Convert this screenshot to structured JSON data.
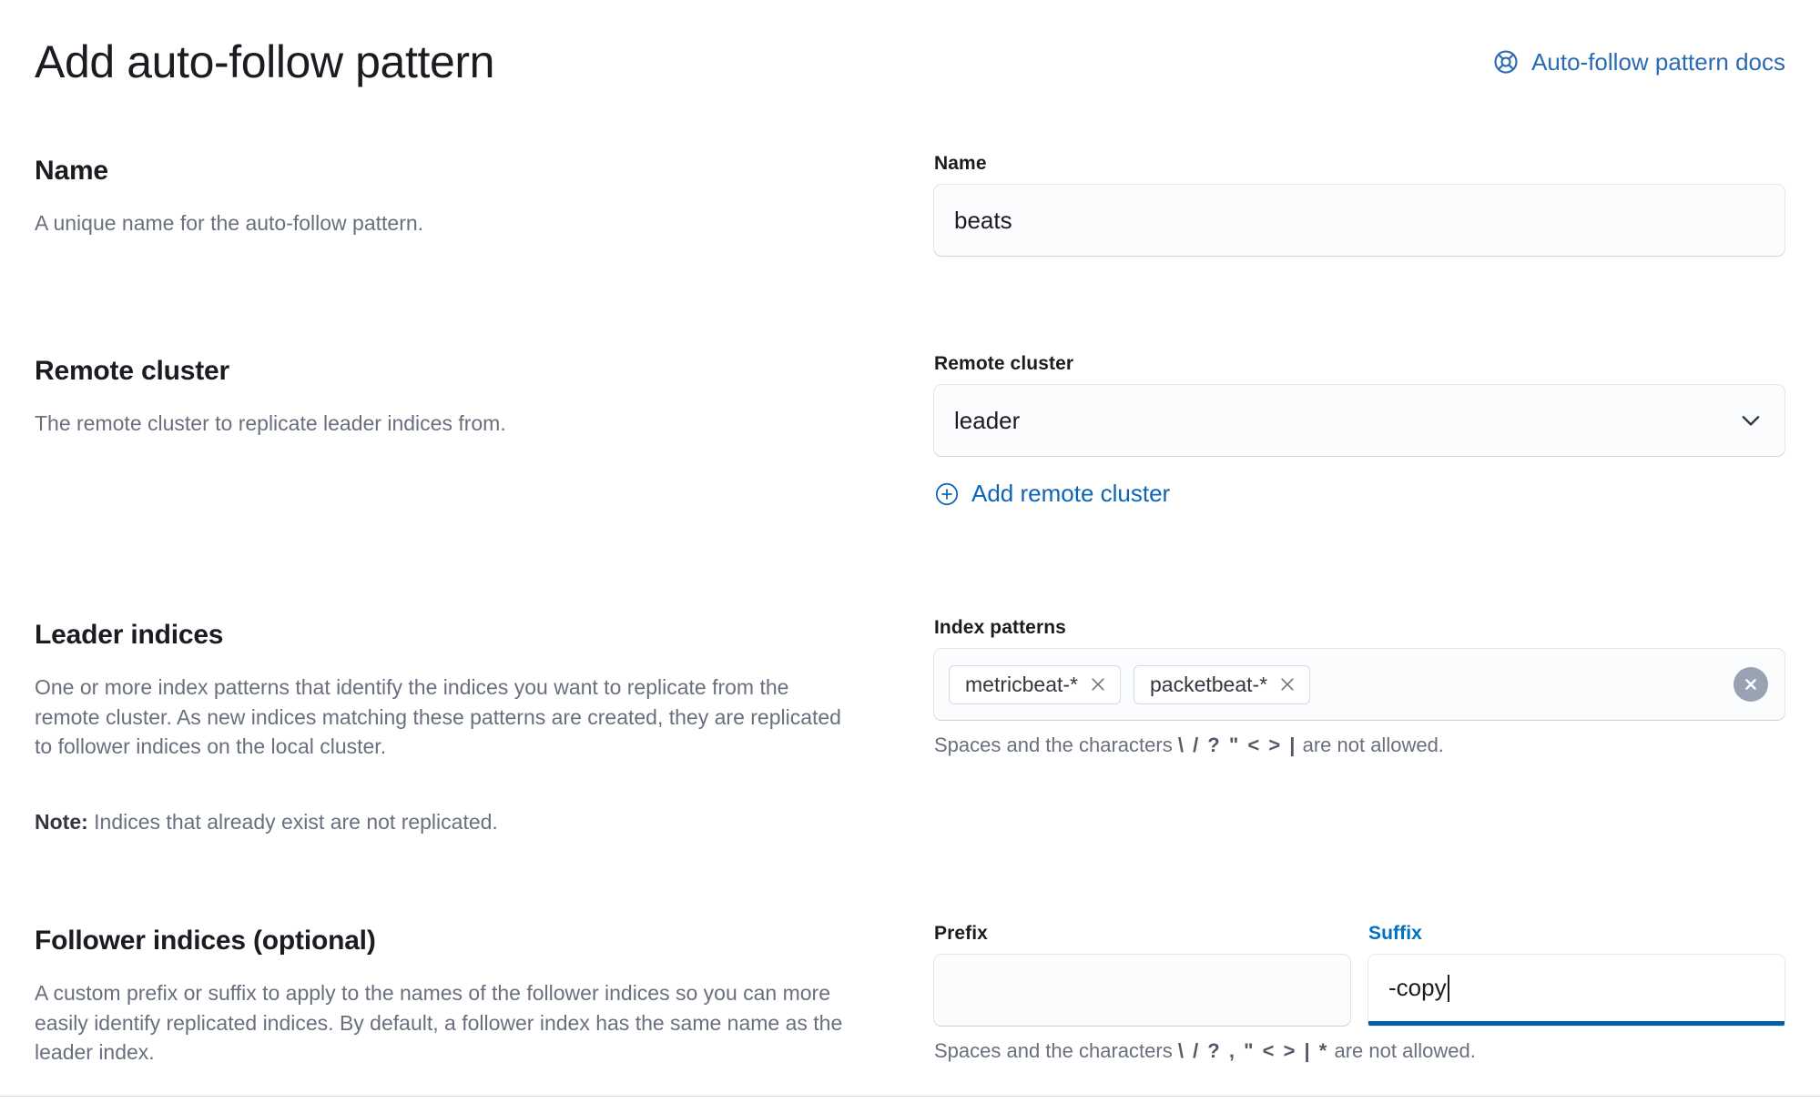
{
  "header": {
    "title": "Add auto-follow pattern",
    "docs_link_label": "Auto-follow pattern docs",
    "docs_link_icon": "help-lifebuoy-icon",
    "accent_color": "#2a6bb3"
  },
  "sections": {
    "name": {
      "title": "Name",
      "description": "A unique name for the auto-follow pattern.",
      "field_label": "Name",
      "field_value": "beats",
      "field_placeholder": ""
    },
    "remote_cluster": {
      "title": "Remote cluster",
      "description": "The remote cluster to replicate leader indices from.",
      "field_label": "Remote cluster",
      "selected_option": "leader",
      "options": [
        "leader"
      ],
      "add_link_label": "Add remote cluster",
      "add_link_icon": "plus-in-circle-icon",
      "chevron_icon": "chevron-down-icon"
    },
    "leader_indices": {
      "title": "Leader indices",
      "description": "One or more index patterns that identify the indices you want to replicate from the remote cluster. As new indices matching these patterns are created, they are replicated to follower indices on the local cluster.",
      "note_label": "Note:",
      "note_text": "Indices that already exist are not replicated.",
      "field_label": "Index patterns",
      "pills": [
        "metricbeat-*",
        "packetbeat-*"
      ],
      "clear_icon": "clear-all-circle-icon",
      "help_prefix": "Spaces and the characters",
      "help_chars": "\\ / ? \" < > |",
      "help_suffix": "are not allowed."
    },
    "follower_indices": {
      "title": "Follower indices (optional)",
      "description": "A custom prefix or suffix to apply to the names of the follower indices so you can more easily identify replicated indices. By default, a follower index has the same name as the leader index.",
      "prefix_label": "Prefix",
      "prefix_value": "",
      "suffix_label": "Suffix",
      "suffix_value": "-copy",
      "suffix_focused": true,
      "focus_color": "#0071c2",
      "help_prefix": "Spaces and the characters",
      "help_chars": "\\ / ? , \" < > | *",
      "help_suffix": "are not allowed."
    }
  }
}
